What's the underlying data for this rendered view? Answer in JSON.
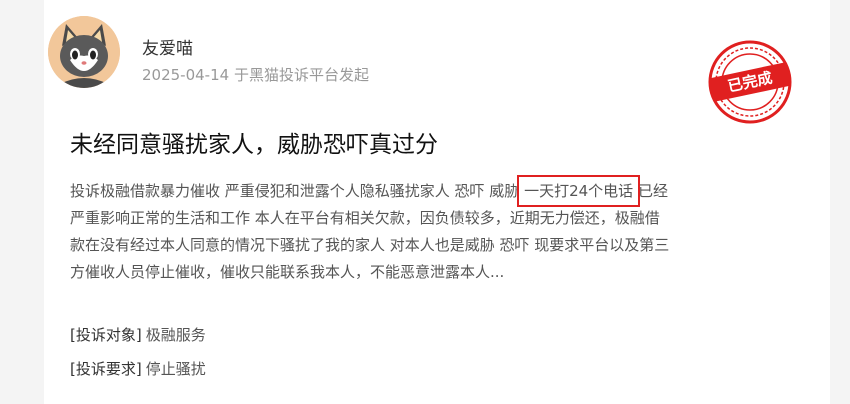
{
  "author": {
    "name": "友爱喵",
    "date": "2025-04-14",
    "origin": "于黑猫投诉平台发起"
  },
  "status_stamp": {
    "label": "已完成",
    "color": "#e02020"
  },
  "complaint": {
    "title": "未经同意骚扰家人，威胁恐吓真过分",
    "body_lines": [
      {
        "before": "投诉极融借款暴力催收 严重侵犯和泄露个人隐私骚扰家人 恐吓 威胁 ",
        "highlight": "一天打24个电话",
        "after": " 已经"
      },
      {
        "text": "严重影响正常的生活和工作 本人在平台有相关欠款，因负债较多，近期无力偿还，极融借"
      },
      {
        "text": "款在没有经过本人同意的情况下骚扰了我的家人 对本人也是威胁 恐吓 现要求平台以及第三"
      },
      {
        "text": "方催收人员停止催收，催收只能联系我本人，不能恶意泄露本人..."
      }
    ],
    "target_label": "[投诉对象]",
    "target_value": "极融服务",
    "demand_label": "[投诉要求]",
    "demand_value": "停止骚扰"
  },
  "colors": {
    "highlight_border": "#e02020",
    "stamp": "#e02020"
  },
  "icons": [
    "cat-avatar-icon",
    "completed-stamp-icon"
  ]
}
